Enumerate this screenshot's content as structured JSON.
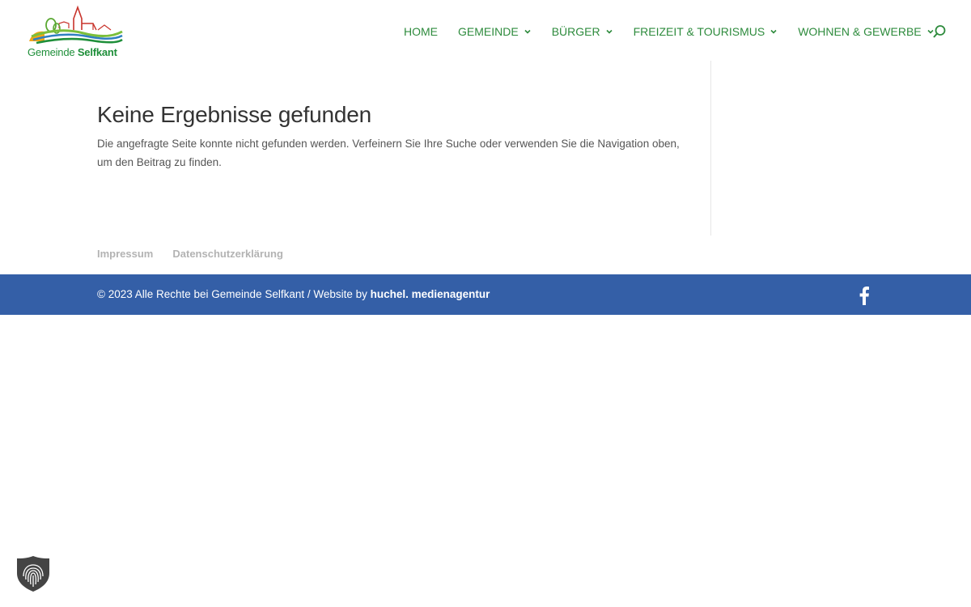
{
  "header": {
    "logo": {
      "text_prefix": "Gemeinde",
      "text_strong": "Selfkant"
    },
    "nav": [
      {
        "label": "HOME",
        "dropdown": false
      },
      {
        "label": "GEMEINDE",
        "dropdown": true
      },
      {
        "label": "BÜRGER",
        "dropdown": true
      },
      {
        "label": "FREIZEIT & TOURISMUS",
        "dropdown": true
      },
      {
        "label": "WOHNEN & GEWERBE",
        "dropdown": true
      }
    ],
    "search_icon": "search-icon"
  },
  "main": {
    "title": "Keine Ergebnisse gefunden",
    "text": "Die angefragte Seite konnte nicht gefunden werden. Verfeinern Sie Ihre Suche oder verwenden Sie die Navigation oben, um den Beitrag zu finden."
  },
  "footer_menu": {
    "items": [
      "Impressum",
      "Datenschutzerklärung"
    ]
  },
  "footer_bar": {
    "copyright_text": "© 2023 Alle Rechte bei Gemeinde Selfkant / Website by ",
    "agency_link": "huchel. medienagentur",
    "social_icon": "facebook-icon"
  },
  "widgets": {
    "privacy_icon": "fingerprint-shield-icon"
  },
  "colors": {
    "nav": "#2e8b3d",
    "footer_bar": "#345fa7",
    "footer_link": "#b3b3b3",
    "title": "#333333",
    "body_text": "#555555"
  }
}
